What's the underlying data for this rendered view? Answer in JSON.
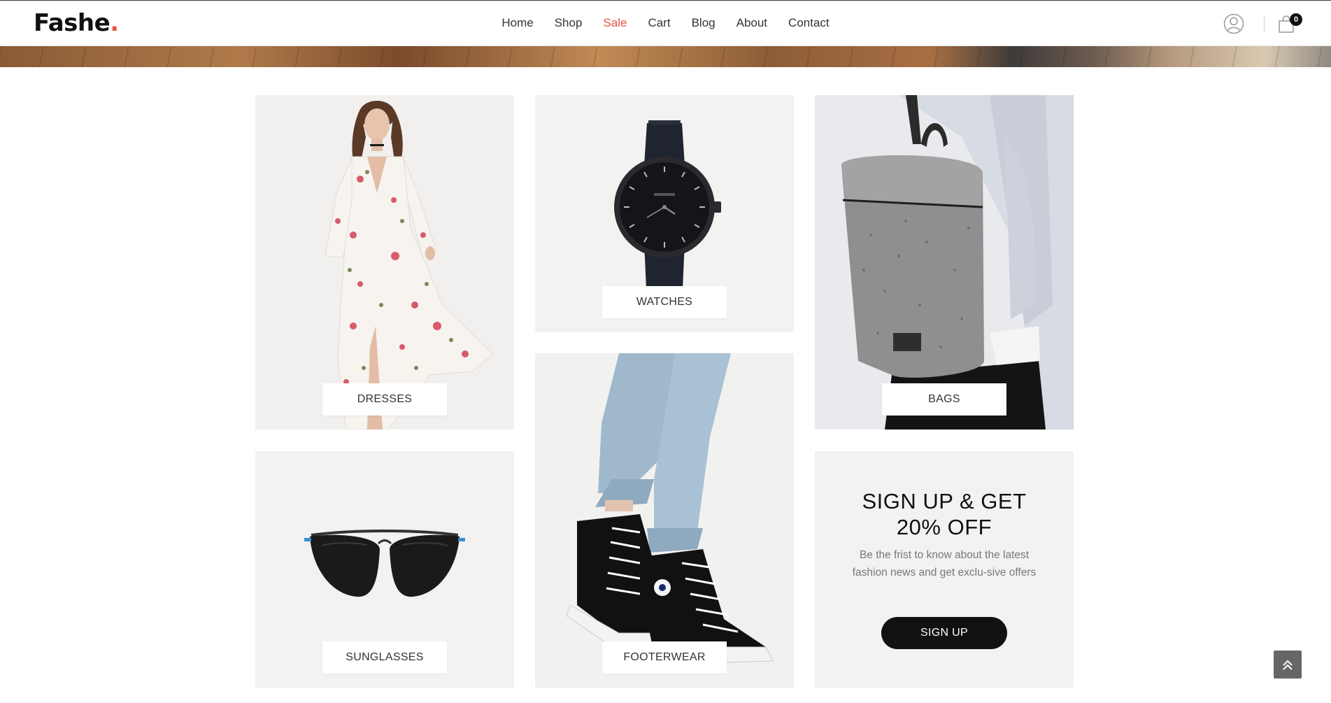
{
  "header": {
    "logo_text": "Fashe",
    "logo_dot": ".",
    "nav": [
      {
        "label": "Home"
      },
      {
        "label": "Shop"
      },
      {
        "label": "Sale"
      },
      {
        "label": "Cart"
      },
      {
        "label": "Blog"
      },
      {
        "label": "About"
      },
      {
        "label": "Contact"
      }
    ],
    "cart_count": "0",
    "icons": {
      "account": "user-icon",
      "cart": "shopping-bag-icon"
    }
  },
  "colors": {
    "accent": "#e65540",
    "dark": "#111111"
  },
  "categories": {
    "dresses": {
      "label": "DRESSES"
    },
    "watches": {
      "label": "WATCHES"
    },
    "bags": {
      "label": "BAGS"
    },
    "sunglasses": {
      "label": "SUNGLASSES"
    },
    "footwear": {
      "label": "FOOTERWEAR"
    }
  },
  "signup": {
    "title_line1": "SIGN UP & GET",
    "title_line2": "20% OFF",
    "text": "Be the frist to know about the latest fashion news and get exclu-sive offers",
    "button": "SIGN UP"
  },
  "back_to_top_icon": "double-chevron-up-icon"
}
